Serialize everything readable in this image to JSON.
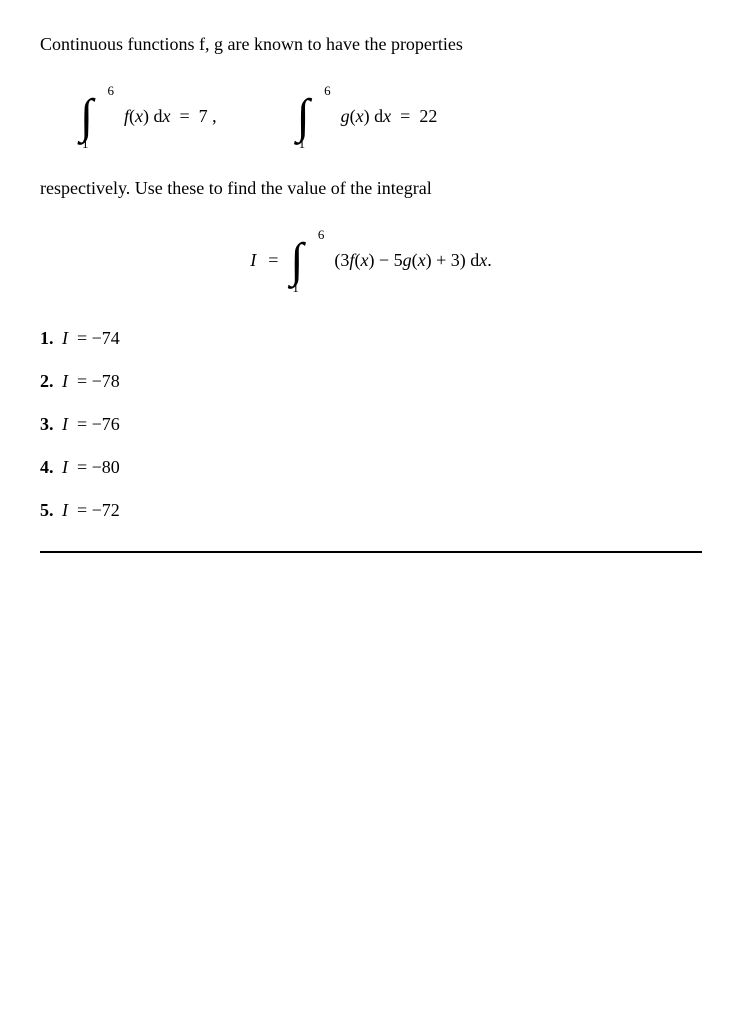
{
  "problem": {
    "intro": "Continuous functions f, g are known to have the properties",
    "integral1": {
      "lower": "1",
      "upper": "6",
      "integrand": "f(x) dx",
      "equals": "7"
    },
    "integral2": {
      "lower": "1",
      "upper": "6",
      "integrand": "g(x) dx",
      "equals": "22"
    },
    "followup": "respectively.  Use these to find the value of the integral",
    "main_integral": {
      "label": "I",
      "lower": "1",
      "upper": "6",
      "integrand": "(3f(x) − 5g(x) + 3) dx."
    },
    "options": [
      {
        "number": "1.",
        "expr": "I  =  −74"
      },
      {
        "number": "2.",
        "expr": "I  =  −78"
      },
      {
        "number": "3.",
        "expr": "I  =  −76"
      },
      {
        "number": "4.",
        "expr": "I  =  −80"
      },
      {
        "number": "5.",
        "expr": "I  =  −72"
      }
    ]
  }
}
